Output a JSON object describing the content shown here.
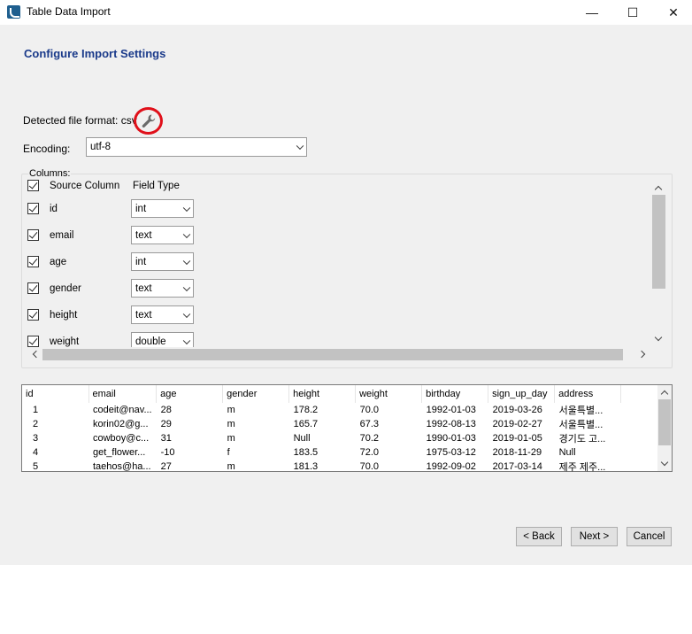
{
  "window": {
    "title": "Table Data Import",
    "minimize_glyph": "—",
    "maximize_glyph": "☐",
    "close_glyph": "✕"
  },
  "page": {
    "title": "Configure Import Settings"
  },
  "format": {
    "label": "Detected file format: csv",
    "icon": "wrench-icon",
    "highlight_color": "#e0101a"
  },
  "encoding": {
    "label": "Encoding:",
    "value": "utf-8"
  },
  "columns": {
    "group_label": "Columns:",
    "header_source": "Source Column",
    "header_type": "Field Type",
    "rows": [
      {
        "name": "id",
        "type": "int",
        "checked": true
      },
      {
        "name": "email",
        "type": "text",
        "checked": true
      },
      {
        "name": "age",
        "type": "int",
        "checked": true
      },
      {
        "name": "gender",
        "type": "text",
        "checked": true
      },
      {
        "name": "height",
        "type": "text",
        "checked": true
      },
      {
        "name": "weight",
        "type": "double",
        "checked": true
      }
    ]
  },
  "preview": {
    "headers": [
      "id",
      "email",
      "age",
      "gender",
      "height",
      "weight",
      "birthday",
      "sign_up_day",
      "address"
    ],
    "rows": [
      [
        "1",
        "codeit@nav...",
        "28",
        "m",
        "178.2",
        "70.0",
        "1992-01-03",
        "2019-03-26",
        "서울특별..."
      ],
      [
        "2",
        "korin02@g...",
        "29",
        "m",
        "165.7",
        "67.3",
        "1992-08-13",
        "2019-02-27",
        "서울특별..."
      ],
      [
        "3",
        "cowboy@c...",
        "31",
        "m",
        "Null",
        "70.2",
        "1990-01-03",
        "2019-01-05",
        "경기도 고..."
      ],
      [
        "4",
        "get_flower...",
        "-10",
        "f",
        "183.5",
        "72.0",
        "1975-03-12",
        "2018-11-29",
        "Null"
      ],
      [
        "5",
        "taehos@ha...",
        "27",
        "m",
        "181.3",
        "70.0",
        "1992-09-02",
        "2017-03-14",
        "제주 제주..."
      ]
    ]
  },
  "buttons": {
    "back": "< Back",
    "next": "Next >",
    "cancel": "Cancel"
  },
  "colors": {
    "title": "#1a3a8a",
    "dialog_bg": "#f0f0f0"
  }
}
